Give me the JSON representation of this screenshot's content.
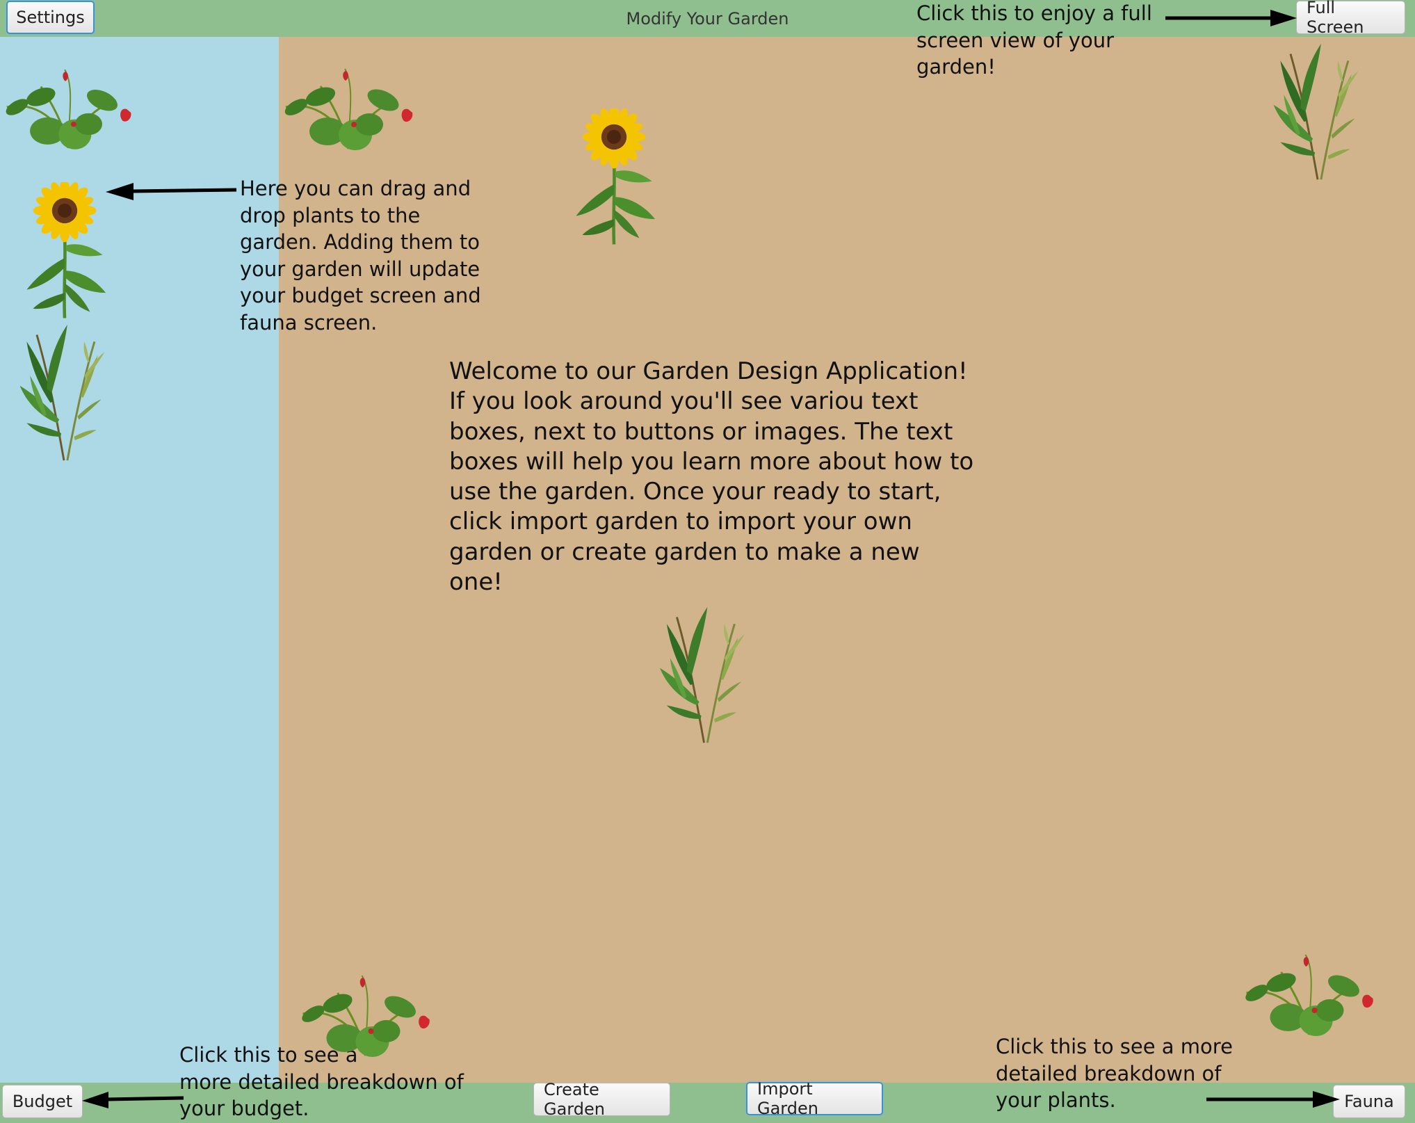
{
  "header": {
    "settings_label": "Settings",
    "title": "Modify Your Garden",
    "fullscreen_label": "Full Screen"
  },
  "footer": {
    "budget_label": "Budget",
    "create_label": "Create Garden",
    "import_label": "Import Garden",
    "fauna_label": "Fauna"
  },
  "help": {
    "fullscreen": "Click this to enjoy a full\nscreen view of your\ngarden!",
    "drag": "Here you can drag and\ndrop plants to the\ngarden. Adding them to\nyour garden will update\nyour budget screen and\nfauna screen.",
    "budget": "Click this to see a\nmore detailed breakdown of\nyour budget.",
    "fauna": "Click this to see a more\ndetailed breakdown of\nyour plants."
  },
  "welcome": "Welcome to our Garden Design Application!\nIf you look around you'll see variou text\nboxes, next to buttons or images. The text\nboxes will help you learn more about how to\nuse the garden. Once your ready to start,\nclick import garden to import your own\ngarden or create garden to make a new one!",
  "palette": {
    "sidebar": "#add8e6",
    "garden": "#d2b48c",
    "bars": "#8fbf8f"
  },
  "plants": {
    "sidebar": [
      "strawberry-plant",
      "sunflower-plant",
      "willow-plant"
    ],
    "garden": [
      "strawberry-plant",
      "sunflower-plant",
      "willow-plant",
      "willow-plant",
      "strawberry-plant",
      "strawberry-plant"
    ]
  }
}
